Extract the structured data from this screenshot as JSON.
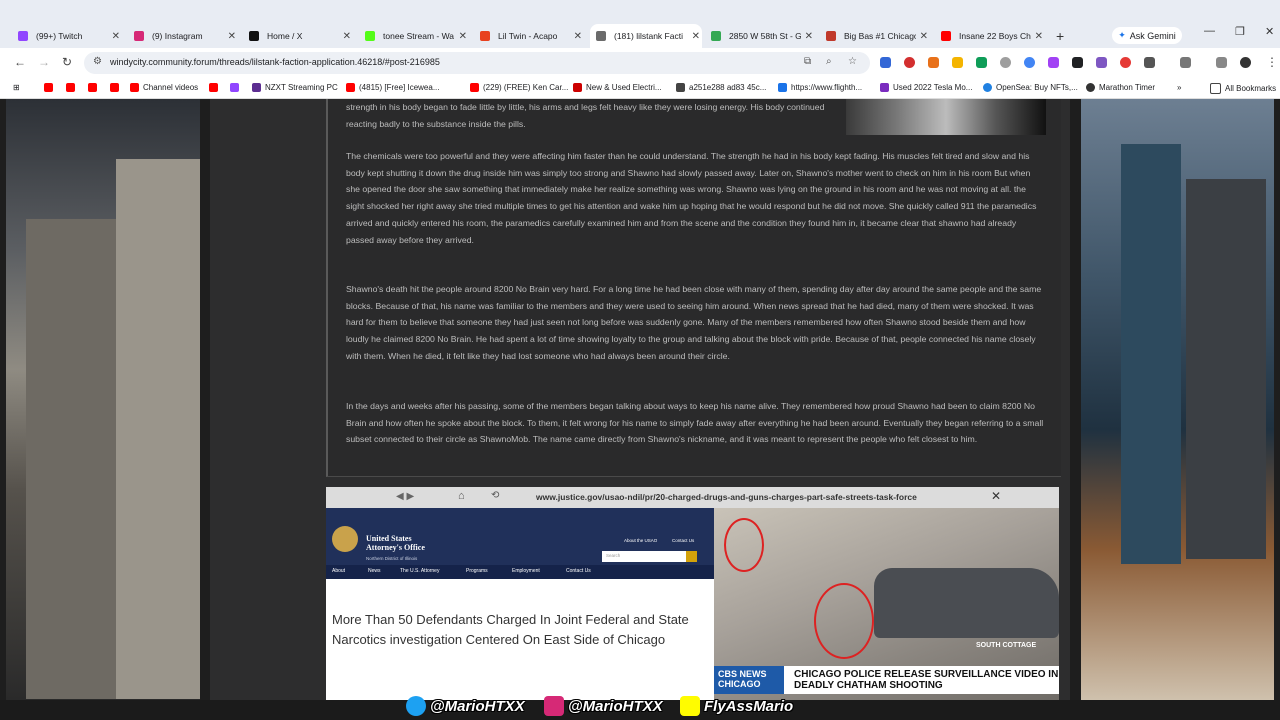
{
  "tabs": [
    {
      "title": "(99+) Twitch",
      "color": "#9146ff"
    },
    {
      "title": "(9) Instagram",
      "color": "#d62976"
    },
    {
      "title": "Home / X",
      "color": "#111111"
    },
    {
      "title": "tonee Stream - Wa",
      "color": "#53fc18"
    },
    {
      "title": "Lil Twin - Acapo",
      "color": "#e8411f"
    },
    {
      "title": "(181) lilstank Facti",
      "color": "#6b6b6b"
    },
    {
      "title": "2850 W 58th St - G",
      "color": "#34a853"
    },
    {
      "title": "Big Bas #1 Chicago",
      "color": "#c0392b"
    },
    {
      "title": "Insane 22 Boys Chi",
      "color": "#ff0000"
    }
  ],
  "new_tab": "+",
  "ask_gemini": "Ask Gemini",
  "url": "windycity.community.forum/threads/lilstank-faction-application.46218/#post-216985",
  "bookmarks": [
    {
      "label": "",
      "color": "#ff0000"
    },
    {
      "label": "",
      "color": "#ff0000"
    },
    {
      "label": "",
      "color": "#ff0000"
    },
    {
      "label": "",
      "color": "#ff0000"
    },
    {
      "label": "Channel videos",
      "color": "#ff0000"
    },
    {
      "label": "",
      "color": "#ff0000"
    },
    {
      "label": "",
      "color": "#9146ff"
    },
    {
      "label": "NZXT Streaming PC",
      "color": "#5c2d91"
    },
    {
      "label": "(4815) [Free] Icewea...",
      "color": "#ff0000"
    },
    {
      "label": "(229) (FREE) Ken Car...",
      "color": "#ff0000"
    },
    {
      "label": "New & Used Electri...",
      "color": "#cc0000"
    },
    {
      "label": "a251e288 ad83 45c...",
      "color": "#444444"
    },
    {
      "label": "https://www.flighth...",
      "color": "#1a73e8"
    },
    {
      "label": "Used 2022 Tesla Mo...",
      "color": "#7b2cbf"
    },
    {
      "label": "OpenSea: Buy NFTs,...",
      "color": "#2081e2"
    },
    {
      "label": "Marathon Timer",
      "color": "#333333"
    }
  ],
  "all_bookmarks": "All Bookmarks",
  "post": {
    "paragraphs": [
      "strength in his body began to fade little by little, his arms and legs felt heavy like they were losing energy. His body continued reacting badly to the substance inside the pills.",
      "The chemicals were too powerful and they were affecting him faster than he could understand. The strength he had in his body kept fading. His muscles felt tired and slow and his body kept shutting it down the drug inside him was simply too strong and Shawno had slowly passed away. Later on, Shawno's mother went to check on him in his room But when she opened the door she saw something that immediately make her realize something was wrong. Shawno was lying on the ground in his room and he was not moving at all. the sight shocked her right away she tried multiple times to get his attention and wake him up hoping that he would respond but he did not move. She quickly called 911 the paramedics arrived and quickly entered his room, the paramedics carefully examined him and from the scene and the condition they found him in, it became clear that shawno had already passed away before they arrived.",
      "Shawno's death hit the people around 8200 No Brain very hard. For a long time he had been close with many of them, spending day after day around the same people and the same blocks. Because of that, his name was familiar to the members and they were used to seeing him around. When news spread that he had died, many of them were shocked. It was hard for them to believe that someone they had just seen not long before was suddenly gone. Many of the members remembered how often Shawno stood beside them and how loudly he claimed 8200 No Brain. He had spent a lot of time showing loyalty to the group and talking about the block with pride. Because of that, people connected his name closely with them. When he died, it felt like they had lost someone who had always been around their circle.",
      "In the days and weeks after his passing, some of the members began talking about ways to keep his name alive. They remembered how proud Shawno had been to claim 8200 No Brain and how often he spoke about the block. To them, it felt wrong for his name to simply fade away after everything he had been around. Eventually they began referring to a small subset connected to their circle as ShawnoMob. The name came directly from Shawno's nickname, and it was meant to represent the people who felt closest to him."
    ]
  },
  "embed": {
    "url": "www.justice.gov/usao-ndil/pr/20-charged-drugs-and-guns-charges-part-safe-streets-task-force",
    "doj_name": "United States\nAttorney's Office",
    "doj_district": "Northern District of Illinois",
    "doj_nav": [
      "About",
      "News",
      "The U.S. Attorney",
      "Programs",
      "Employment",
      "Contact Us"
    ],
    "doj_links": [
      "About the USAO",
      "Contact Us"
    ],
    "search_placeholder": "Search",
    "headline": "More Than 50 Defendants Charged In Joint Federal and State Narcotics investigation Centered On East Side of Chicago",
    "cbs_logo": "CBS NEWS\nCHICAGO",
    "cbs_headline": "CHICAGO POLICE RELEASE SURVEILLANCE VIDEO IN DEADLY CHATHAM SHOOTING",
    "video_corner": "SOUTH COTTAGE"
  },
  "social": [
    {
      "handle": "@MarioHTXX",
      "color": "#1da1f2",
      "icon": "twitter-icon"
    },
    {
      "handle": "@MarioHTXX",
      "color": "#d62976",
      "icon": "instagram-icon"
    },
    {
      "handle": "FlyAssMario",
      "color": "#fffc00",
      "icon": "snapchat-icon"
    }
  ]
}
